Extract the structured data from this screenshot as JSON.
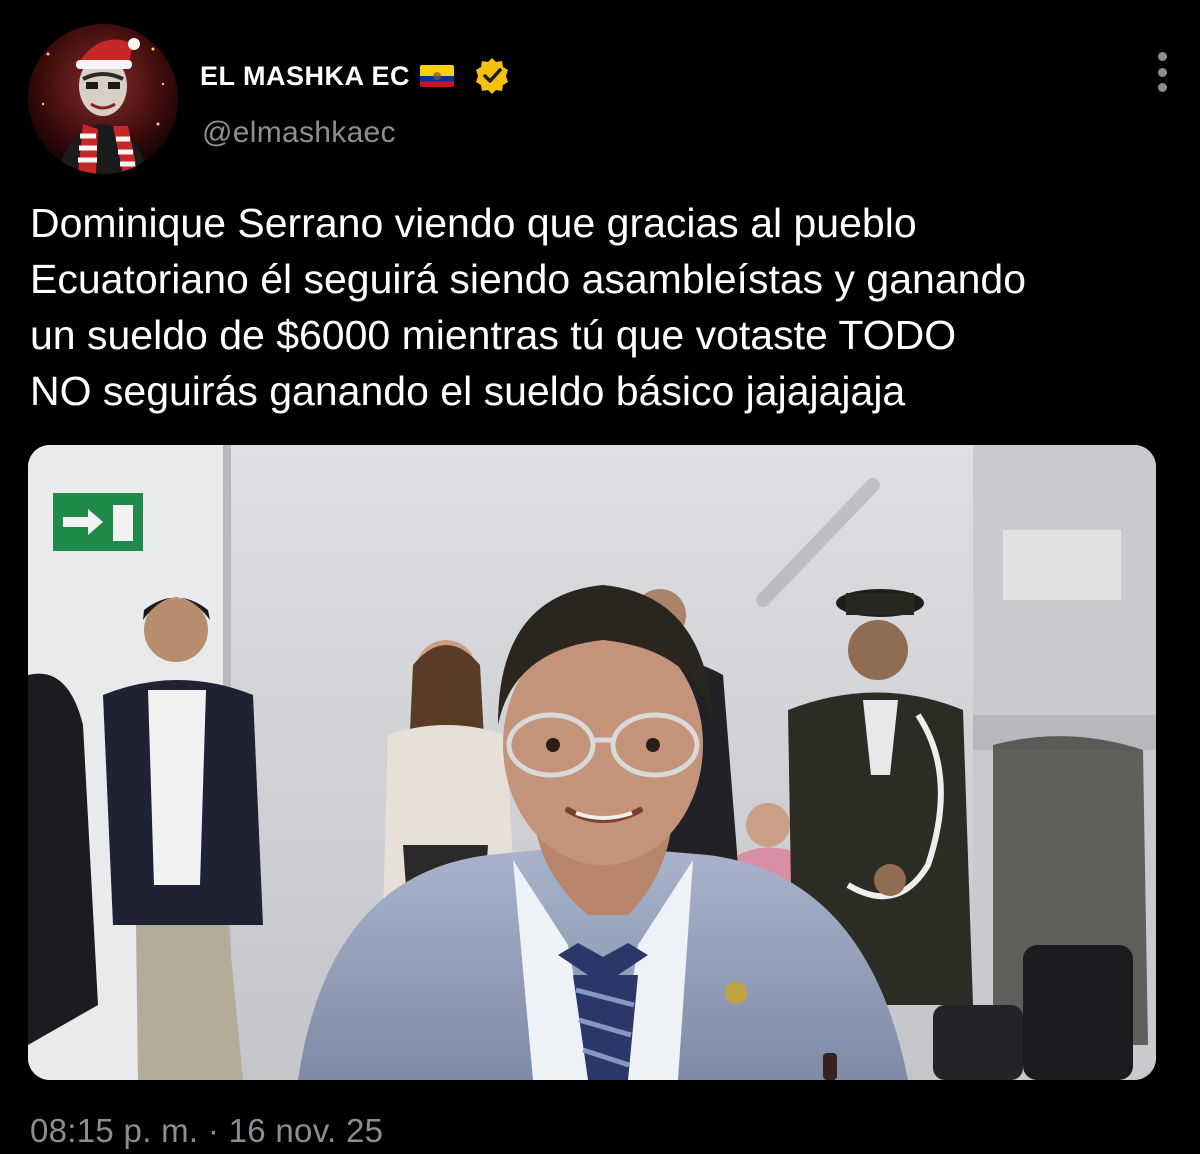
{
  "tweet": {
    "author": {
      "display_name": "EL MASHKA EC",
      "handle": "@elmashkaec",
      "flag_icon": "ecuador-flag-emoji",
      "verified_icon": "verified-badge-gold",
      "verified_color": "#f4c20d"
    },
    "text": "Dominique Serrano viendo que gracias al pueblo\nEcuatoriano él seguirá siendo asambleístas y ganando\nun sueldo de $6000 mientras tú que votaste TODO\nNO seguirás ganando el sueldo básico jajajajaja",
    "timestamp": "08:15 p. m. · 16 nov. 25",
    "more_icon": "vertical-ellipsis"
  },
  "theme": {
    "background": "#000000",
    "text_primary": "#ffffff",
    "text_secondary": "#8b8f94"
  }
}
